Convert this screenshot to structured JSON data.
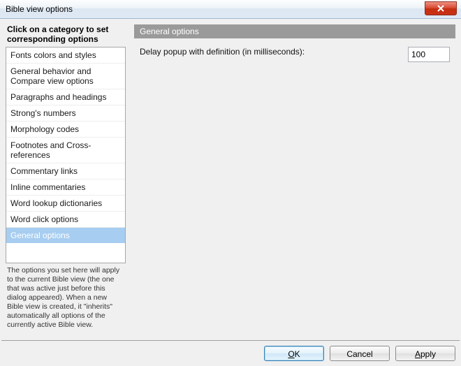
{
  "window": {
    "title": "Bible view options"
  },
  "sidebar": {
    "heading": "Click on a category to set corresponding options",
    "items": [
      "Fonts colors and styles",
      "General behavior and Compare view options",
      "Paragraphs and headings",
      "Strong's numbers",
      "Morphology codes",
      "Footnotes and Cross-references",
      "Commentary links",
      "Inline commentaries",
      "Word lookup dictionaries",
      "Word click options",
      "General options"
    ],
    "selected_index": 10,
    "note": "The options you set here will apply to the current Bible view (the one that was active just before this dialog appeared). When a new Bible view is created, it \"inherits\" automatically all options of the currently active Bible view."
  },
  "panel": {
    "title": "General options",
    "delay_label": "Delay popup with definition (in milliseconds):",
    "delay_value": "100"
  },
  "buttons": {
    "ok_u": "O",
    "ok_rest": "K",
    "cancel": "Cancel",
    "apply_u": "A",
    "apply_rest": "pply"
  }
}
